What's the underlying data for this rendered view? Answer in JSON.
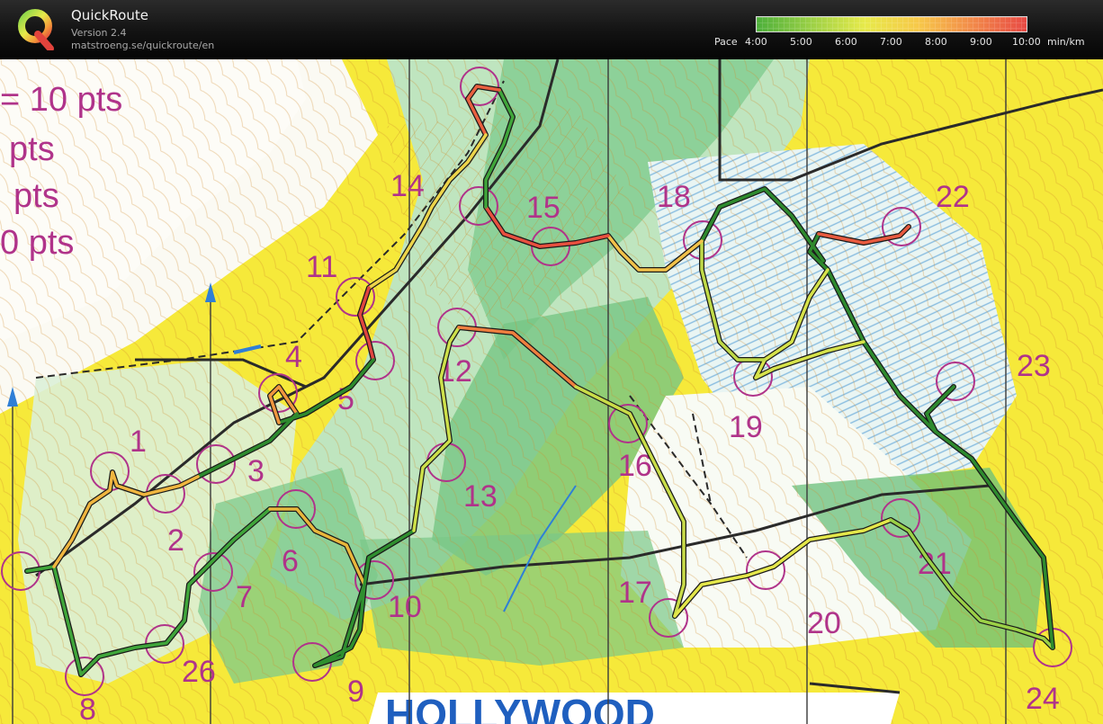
{
  "app": {
    "title": "QuickRoute",
    "version": "Version 2.4",
    "url": "matstroeng.se/quickroute/en",
    "logo_icon": "quickroute-q-logo"
  },
  "pace_legend": {
    "label": "Pace",
    "ticks": [
      "4:00",
      "5:00",
      "6:00",
      "7:00",
      "8:00",
      "9:00",
      "10:00"
    ],
    "unit": "min/km",
    "colors": [
      "#4caf3a",
      "#9bd046",
      "#e7ea4a",
      "#f7c84a",
      "#f28a4a",
      "#e84a45"
    ]
  },
  "map": {
    "points_lines": [
      "= 10 pts",
      "pts",
      "pts",
      "0 pts"
    ],
    "controls": [
      "1",
      "2",
      "3",
      "4",
      "5",
      "6",
      "7",
      "8",
      "9",
      "10",
      "11",
      "12",
      "13",
      "14",
      "15",
      "16",
      "17",
      "18",
      "19",
      "20",
      "21",
      "22",
      "23",
      "24",
      "26"
    ],
    "banner_text": "HOLLYWOOD"
  }
}
